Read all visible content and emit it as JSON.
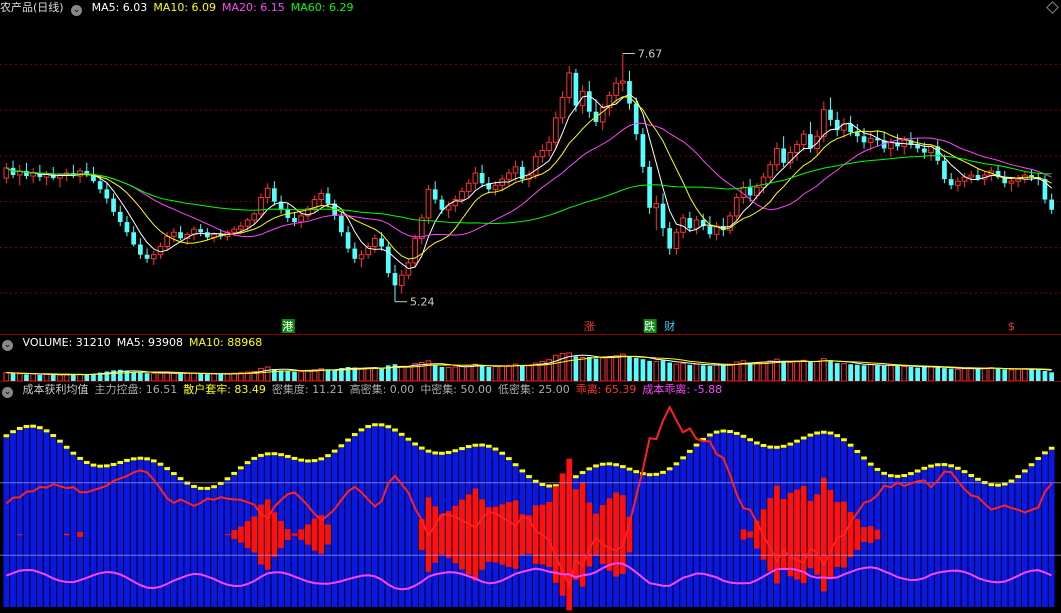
{
  "price_panel": {
    "title": "农产品(日线)",
    "ma_items": [
      {
        "label": "MA5: 6.03",
        "color": "#ffffff"
      },
      {
        "label": "MA10: 6.09",
        "color": "#ffff00"
      },
      {
        "label": "MA20: 6.15",
        "color": "#ff44ff"
      },
      {
        "label": "MA60: 6.29",
        "color": "#00ff00"
      }
    ],
    "high_label": "7.67",
    "low_label": "5.24",
    "event_markers": [
      {
        "text": "港",
        "bg": "#118811",
        "color": "#ffffff",
        "idx": 42
      },
      {
        "text": "涨",
        "bg": "#000000",
        "color": "#ff3333",
        "idx": 87
      },
      {
        "text": "跌",
        "bg": "#118811",
        "color": "#ffffff",
        "idx": 96
      },
      {
        "text": "财",
        "bg": "#000000",
        "color": "#33ccff",
        "idx": 99
      },
      {
        "text": "$",
        "bg": "#000000",
        "color": "#ff3333",
        "idx": 150
      }
    ]
  },
  "volume_panel": {
    "items": [
      {
        "label": "VOLUME: 31210",
        "color": "#ffffff"
      },
      {
        "label": "MA5: 93908",
        "color": "#ffffff"
      },
      {
        "label": "MA10: 88968",
        "color": "#ffff00"
      }
    ]
  },
  "cost_panel": {
    "items": [
      {
        "label": "成本获利均值",
        "color": "#cccccc"
      },
      {
        "label": "主力控盘: 16.51",
        "color": "#aaaaaa"
      },
      {
        "label": "散户套牢: 83.49",
        "color": "#ffff00"
      },
      {
        "label": "密集度: 11.21",
        "color": "#aaaaaa"
      },
      {
        "label": "高密集: 0.00",
        "color": "#aaaaaa"
      },
      {
        "label": "中密集: 50.00",
        "color": "#aaaaaa"
      },
      {
        "label": "低密集: 25.00",
        "color": "#aaaaaa"
      },
      {
        "label": "乖离: 65.39",
        "color": "#ff3333"
      },
      {
        "label": "成本乖离: -5.88",
        "color": "#ff44ff"
      }
    ]
  },
  "chart_data": {
    "type": "candlestick",
    "title": "农产品(日线)",
    "indicators": [
      "MA5",
      "MA10",
      "MA20",
      "MA60"
    ],
    "ylim": [
      5.1,
      7.9
    ],
    "ohlc": [
      [
        6.45,
        6.6,
        6.4,
        6.55
      ],
      [
        6.55,
        6.62,
        6.45,
        6.48
      ],
      [
        6.48,
        6.58,
        6.38,
        6.52
      ],
      [
        6.52,
        6.6,
        6.44,
        6.47
      ],
      [
        6.47,
        6.55,
        6.4,
        6.5
      ],
      [
        6.5,
        6.58,
        6.42,
        6.46
      ],
      [
        6.46,
        6.52,
        6.38,
        6.49
      ],
      [
        6.49,
        6.56,
        6.43,
        6.45
      ],
      [
        6.45,
        6.5,
        6.36,
        6.48
      ],
      [
        6.48,
        6.54,
        6.42,
        6.5
      ],
      [
        6.5,
        6.58,
        6.45,
        6.47
      ],
      [
        6.47,
        6.55,
        6.4,
        6.52
      ],
      [
        6.52,
        6.6,
        6.46,
        6.49
      ],
      [
        6.49,
        6.56,
        6.4,
        6.42
      ],
      [
        6.42,
        6.48,
        6.3,
        6.34
      ],
      [
        6.34,
        6.4,
        6.2,
        6.25
      ],
      [
        6.25,
        6.3,
        6.08,
        6.12
      ],
      [
        6.12,
        6.18,
        5.98,
        6.02
      ],
      [
        6.02,
        6.08,
        5.88,
        5.92
      ],
      [
        5.92,
        5.98,
        5.78,
        5.8
      ],
      [
        5.8,
        5.86,
        5.66,
        5.7
      ],
      [
        5.7,
        5.76,
        5.62,
        5.66
      ],
      [
        5.66,
        5.74,
        5.6,
        5.7
      ],
      [
        5.7,
        5.82,
        5.66,
        5.78
      ],
      [
        5.78,
        5.92,
        5.74,
        5.88
      ],
      [
        5.88,
        5.96,
        5.82,
        5.92
      ],
      [
        5.92,
        5.98,
        5.84,
        5.86
      ],
      [
        5.86,
        5.92,
        5.8,
        5.9
      ],
      [
        5.9,
        5.98,
        5.84,
        5.95
      ],
      [
        5.95,
        6.0,
        5.88,
        5.92
      ],
      [
        5.92,
        5.96,
        5.84,
        5.87
      ],
      [
        5.87,
        5.92,
        5.82,
        5.9
      ],
      [
        5.9,
        5.95,
        5.85,
        5.88
      ],
      [
        5.88,
        5.94,
        5.84,
        5.92
      ],
      [
        5.92,
        5.98,
        5.88,
        5.95
      ],
      [
        5.95,
        6.02,
        5.9,
        5.98
      ],
      [
        5.98,
        6.06,
        5.94,
        6.04
      ],
      [
        6.04,
        6.12,
        6.0,
        6.1
      ],
      [
        6.1,
        6.3,
        6.06,
        6.26
      ],
      [
        6.26,
        6.4,
        6.2,
        6.35
      ],
      [
        6.35,
        6.42,
        6.18,
        6.22
      ],
      [
        6.22,
        6.28,
        6.1,
        6.14
      ],
      [
        6.14,
        6.2,
        6.02,
        6.06
      ],
      [
        6.06,
        6.12,
        5.98,
        6.02
      ],
      [
        6.02,
        6.1,
        5.96,
        6.08
      ],
      [
        6.08,
        6.18,
        6.04,
        6.15
      ],
      [
        6.15,
        6.28,
        6.12,
        6.24
      ],
      [
        6.24,
        6.34,
        6.18,
        6.3
      ],
      [
        6.3,
        6.36,
        6.16,
        6.2
      ],
      [
        6.2,
        6.24,
        6.04,
        6.08
      ],
      [
        6.08,
        6.12,
        5.88,
        5.92
      ],
      [
        5.92,
        5.98,
        5.72,
        5.76
      ],
      [
        5.76,
        5.82,
        5.62,
        5.66
      ],
      [
        5.66,
        5.74,
        5.58,
        5.7
      ],
      [
        5.7,
        5.82,
        5.66,
        5.78
      ],
      [
        5.78,
        5.9,
        5.72,
        5.86
      ],
      [
        5.86,
        5.92,
        5.74,
        5.78
      ],
      [
        5.78,
        5.82,
        5.48,
        5.52
      ],
      [
        5.52,
        5.6,
        5.24,
        5.4
      ],
      [
        5.4,
        5.55,
        5.32,
        5.5
      ],
      [
        5.5,
        5.66,
        5.46,
        5.62
      ],
      [
        5.62,
        5.9,
        5.58,
        5.86
      ],
      [
        5.86,
        6.1,
        5.8,
        6.06
      ],
      [
        6.06,
        6.38,
        6.0,
        6.34
      ],
      [
        6.34,
        6.42,
        6.2,
        6.24
      ],
      [
        6.24,
        6.28,
        6.1,
        6.14
      ],
      [
        6.14,
        6.22,
        6.06,
        6.18
      ],
      [
        6.18,
        6.28,
        6.12,
        6.24
      ],
      [
        6.24,
        6.36,
        6.2,
        6.32
      ],
      [
        6.32,
        6.44,
        6.26,
        6.4
      ],
      [
        6.4,
        6.56,
        6.34,
        6.5
      ],
      [
        6.5,
        6.58,
        6.36,
        6.4
      ],
      [
        6.4,
        6.46,
        6.3,
        6.34
      ],
      [
        6.34,
        6.42,
        6.28,
        6.38
      ],
      [
        6.38,
        6.48,
        6.32,
        6.44
      ],
      [
        6.44,
        6.54,
        6.38,
        6.5
      ],
      [
        6.5,
        6.62,
        6.42,
        6.56
      ],
      [
        6.56,
        6.62,
        6.4,
        6.44
      ],
      [
        6.44,
        6.52,
        6.36,
        6.48
      ],
      [
        6.48,
        6.7,
        6.44,
        6.66
      ],
      [
        6.66,
        6.78,
        6.6,
        6.72
      ],
      [
        6.72,
        6.86,
        6.66,
        6.8
      ],
      [
        6.8,
        7.1,
        6.74,
        7.04
      ],
      [
        7.04,
        7.3,
        6.98,
        7.24
      ],
      [
        7.24,
        7.55,
        7.18,
        7.48
      ],
      [
        7.48,
        7.52,
        7.1,
        7.16
      ],
      [
        7.16,
        7.36,
        7.08,
        7.3
      ],
      [
        7.3,
        7.4,
        7.04,
        7.1
      ],
      [
        7.1,
        7.22,
        6.96,
        7.0
      ],
      [
        7.0,
        7.18,
        6.92,
        7.14
      ],
      [
        7.14,
        7.3,
        7.06,
        7.26
      ],
      [
        7.26,
        7.44,
        7.18,
        7.38
      ],
      [
        7.38,
        7.67,
        7.3,
        7.4
      ],
      [
        7.4,
        7.5,
        7.12,
        7.18
      ],
      [
        7.18,
        7.24,
        6.82,
        6.88
      ],
      [
        6.88,
        6.94,
        6.5,
        6.56
      ],
      [
        6.56,
        6.62,
        6.1,
        6.16
      ],
      [
        6.16,
        6.28,
        5.94,
        6.2
      ],
      [
        6.2,
        6.3,
        5.88,
        5.96
      ],
      [
        5.96,
        6.02,
        5.7,
        5.76
      ],
      [
        5.76,
        5.96,
        5.7,
        5.92
      ],
      [
        5.92,
        6.1,
        5.86,
        6.06
      ],
      [
        6.06,
        6.12,
        5.92,
        5.96
      ],
      [
        5.96,
        6.08,
        5.9,
        6.04
      ],
      [
        6.04,
        6.1,
        5.94,
        5.98
      ],
      [
        5.98,
        6.08,
        5.86,
        5.9
      ],
      [
        5.9,
        6.02,
        5.84,
        5.98
      ],
      [
        5.98,
        6.06,
        5.88,
        5.94
      ],
      [
        5.94,
        6.12,
        5.9,
        6.08
      ],
      [
        6.08,
        6.3,
        6.04,
        6.26
      ],
      [
        6.26,
        6.42,
        6.2,
        6.36
      ],
      [
        6.36,
        6.44,
        6.22,
        6.28
      ],
      [
        6.28,
        6.4,
        6.24,
        6.36
      ],
      [
        6.36,
        6.5,
        6.3,
        6.46
      ],
      [
        6.46,
        6.62,
        6.4,
        6.58
      ],
      [
        6.58,
        6.8,
        6.52,
        6.74
      ],
      [
        6.74,
        6.86,
        6.56,
        6.6
      ],
      [
        6.6,
        6.76,
        6.54,
        6.7
      ],
      [
        6.7,
        6.82,
        6.62,
        6.78
      ],
      [
        6.78,
        6.92,
        6.72,
        6.88
      ],
      [
        6.88,
        7.0,
        6.7,
        6.74
      ],
      [
        6.74,
        6.92,
        6.68,
        6.86
      ],
      [
        6.86,
        7.2,
        6.8,
        7.12
      ],
      [
        7.12,
        7.24,
        6.96,
        7.02
      ],
      [
        7.02,
        7.1,
        6.86,
        6.92
      ],
      [
        6.92,
        7.04,
        6.84,
        6.98
      ],
      [
        6.98,
        7.06,
        6.86,
        6.9
      ],
      [
        6.9,
        6.98,
        6.8,
        6.86
      ],
      [
        6.86,
        6.94,
        6.74,
        6.8
      ],
      [
        6.8,
        6.9,
        6.72,
        6.84
      ],
      [
        6.84,
        6.92,
        6.76,
        6.82
      ],
      [
        6.82,
        6.9,
        6.7,
        6.74
      ],
      [
        6.74,
        6.84,
        6.66,
        6.8
      ],
      [
        6.8,
        6.88,
        6.72,
        6.76
      ],
      [
        6.76,
        6.86,
        6.68,
        6.82
      ],
      [
        6.82,
        6.9,
        6.74,
        6.78
      ],
      [
        6.78,
        6.84,
        6.7,
        6.74
      ],
      [
        6.74,
        6.8,
        6.64,
        6.7
      ],
      [
        6.7,
        6.78,
        6.62,
        6.76
      ],
      [
        6.76,
        6.82,
        6.58,
        6.62
      ],
      [
        6.62,
        6.68,
        6.4,
        6.44
      ],
      [
        6.44,
        6.5,
        6.34,
        6.38
      ],
      [
        6.38,
        6.46,
        6.32,
        6.42
      ],
      [
        6.42,
        6.5,
        6.36,
        6.46
      ],
      [
        6.46,
        6.52,
        6.4,
        6.48
      ],
      [
        6.48,
        6.54,
        6.42,
        6.44
      ],
      [
        6.44,
        6.52,
        6.38,
        6.48
      ],
      [
        6.48,
        6.56,
        6.42,
        6.52
      ],
      [
        6.52,
        6.58,
        6.44,
        6.46
      ],
      [
        6.46,
        6.52,
        6.36,
        6.4
      ],
      [
        6.4,
        6.46,
        6.32,
        6.42
      ],
      [
        6.42,
        6.48,
        6.36,
        6.44
      ],
      [
        6.44,
        6.52,
        6.4,
        6.48
      ],
      [
        6.48,
        6.54,
        6.42,
        6.46
      ],
      [
        6.46,
        6.5,
        6.38,
        6.44
      ],
      [
        6.44,
        6.48,
        6.2,
        6.24
      ],
      [
        6.24,
        6.3,
        6.1,
        6.14
      ]
    ],
    "volume": [
      30,
      28,
      26,
      24,
      25,
      22,
      24,
      23,
      21,
      22,
      25,
      24,
      23,
      26,
      30,
      34,
      38,
      40,
      36,
      32,
      30,
      28,
      26,
      28,
      30,
      28,
      26,
      27,
      28,
      26,
      24,
      25,
      24,
      26,
      28,
      30,
      32,
      34,
      45,
      50,
      42,
      38,
      35,
      33,
      34,
      36,
      40,
      44,
      42,
      40,
      46,
      50,
      48,
      44,
      46,
      48,
      44,
      56,
      60,
      52,
      50,
      62,
      66,
      72,
      58,
      50,
      48,
      50,
      52,
      56,
      60,
      54,
      50,
      52,
      54,
      56,
      60,
      56,
      54,
      64,
      70,
      76,
      92,
      98,
      100,
      88,
      84,
      86,
      80,
      82,
      86,
      90,
      96,
      86,
      82,
      78,
      72,
      70,
      74,
      66,
      60,
      62,
      58,
      60,
      56,
      54,
      58,
      56,
      60,
      68,
      72,
      66,
      64,
      68,
      72,
      78,
      70,
      66,
      70,
      74,
      68,
      70,
      80,
      72,
      64,
      62,
      60,
      58,
      56,
      58,
      56,
      54,
      56,
      54,
      52,
      50,
      48,
      50,
      52,
      48,
      46,
      44,
      42,
      44,
      46,
      44,
      46,
      48,
      44,
      42,
      40,
      42,
      44,
      42,
      40,
      36,
      31
    ]
  }
}
